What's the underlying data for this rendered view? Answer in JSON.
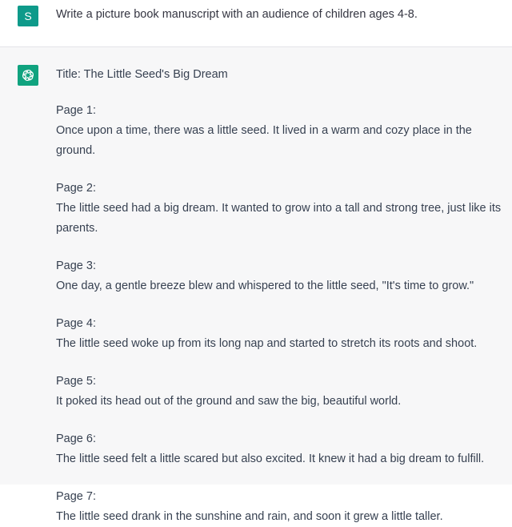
{
  "user": {
    "avatar_letter": "S",
    "avatar_color": "#0e9a8a",
    "message": "Write a picture book manuscript with an audience of children ages 4-8."
  },
  "assistant": {
    "icon": "openai-logo-icon",
    "avatar_color": "#10a37f",
    "title": "Title: The Little Seed's Big Dream",
    "pages": [
      {
        "label": "Page 1:",
        "text": "Once upon a time, there was a little seed. It lived in a warm and cozy place in the ground."
      },
      {
        "label": "Page 2:",
        "text": "The little seed had a big dream. It wanted to grow into a tall and strong tree, just like its parents."
      },
      {
        "label": "Page 3:",
        "text": "One day, a gentle breeze blew and whispered to the little seed, \"It's time to grow.\""
      },
      {
        "label": "Page 4:",
        "text": "The little seed woke up from its long nap and started to stretch its roots and shoot."
      },
      {
        "label": "Page 5:",
        "text": "It poked its head out of the ground and saw the big, beautiful world."
      },
      {
        "label": "Page 6:",
        "text": "The little seed felt a little scared but also excited. It knew it had a big dream to fulfill."
      },
      {
        "label": "Page 7:",
        "text": "The little seed drank in the sunshine and rain, and soon it grew a little taller."
      }
    ]
  }
}
